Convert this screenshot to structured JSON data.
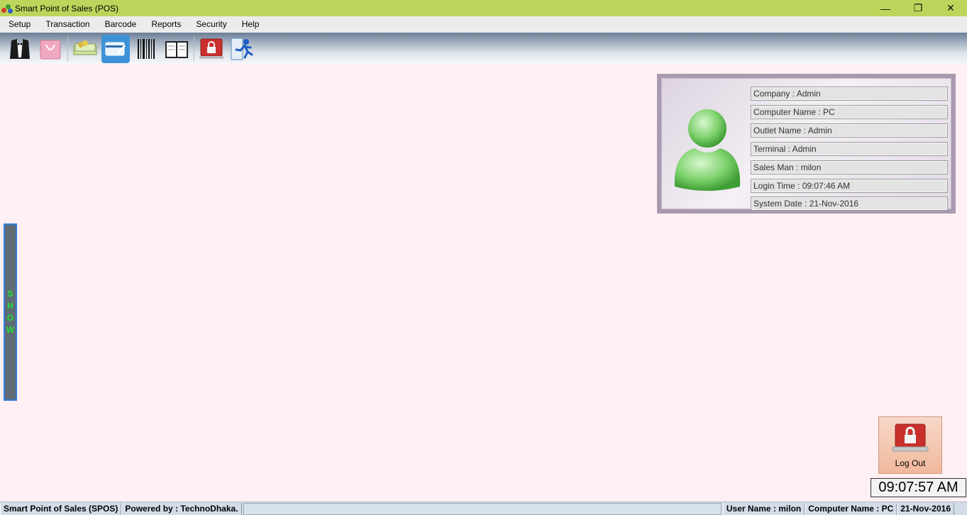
{
  "window": {
    "title": "Smart Point of Sales (POS)",
    "controls": {
      "minimize": "—",
      "maximize": "❐",
      "close": "✕"
    }
  },
  "menu": [
    "Setup",
    "Transaction",
    "Barcode",
    "Reports",
    "Security",
    "Help"
  ],
  "toolbar": {
    "tools": [
      "tuxedo-icon",
      "shopping-bag-icon",
      "money-icon",
      "credit-card-icon",
      "barcode-icon",
      "book-icon",
      "lock-laptop-icon",
      "exit-runner-icon"
    ],
    "active": "credit-card-icon"
  },
  "info": {
    "company": "Company : Admin",
    "computer_name": "Computer Name : PC",
    "outlet_name": "Outlet Name : Admin",
    "terminal": "Terminal : Admin",
    "sales_man": "Sales Man : milon",
    "login_time": "Login Time : 09:07:46 AM",
    "system_date": "System Date : 21-Nov-2016"
  },
  "show_strip": {
    "letters": [
      "S",
      "H",
      "O",
      "W"
    ]
  },
  "logout": {
    "label": "Log Out"
  },
  "clock": {
    "time": "09:07:57 AM"
  },
  "status": {
    "app": "Smart Point of Sales (SPOS)",
    "powered": "Powered by : TechnoDhaka.",
    "user": "User Name : milon",
    "computer": "Computer Name : PC",
    "date": "21-Nov-2016"
  },
  "colors": {
    "titlebar": "#bcd65c",
    "background": "#fff0f4",
    "show_text": "#22e23a",
    "active_tool": "#3e93d8"
  }
}
